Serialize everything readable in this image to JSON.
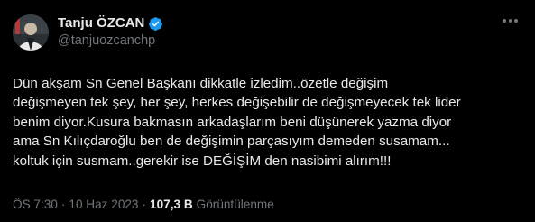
{
  "author": {
    "display_name": "Tanju ÖZCAN",
    "handle": "@tanjuozcanchp",
    "avatar_icon": "profile-photo",
    "verified_icon": "verified-badge-icon",
    "verified_color": "#1d9bf0"
  },
  "tweet": {
    "text": "Dün akşam Sn Genel Başkanı dikkatle izledim..özetle değişim\ndeğişmeyen tek şey, her şey, herkes değişebilir de değişmeyecek tek lider\nbenim diyor.Kusura bakmasın arkadaşlarım beni düşünerek yazma diyor\nama Sn Kılıçdaroğlu ben de değişimin parçasıyım demeden susamam...\nkoltuk için susmam..gerekir ise DEĞİŞİM den nasibimi alırım!!!",
    "time": "ÖS 7:30",
    "date": "10 Haz 2023",
    "views_count": "107,3 B",
    "views_label": "Görüntülenme",
    "separator": "·"
  },
  "colors": {
    "background": "#000000",
    "primary_text": "#e7e9ea",
    "secondary_text": "#71767b"
  }
}
